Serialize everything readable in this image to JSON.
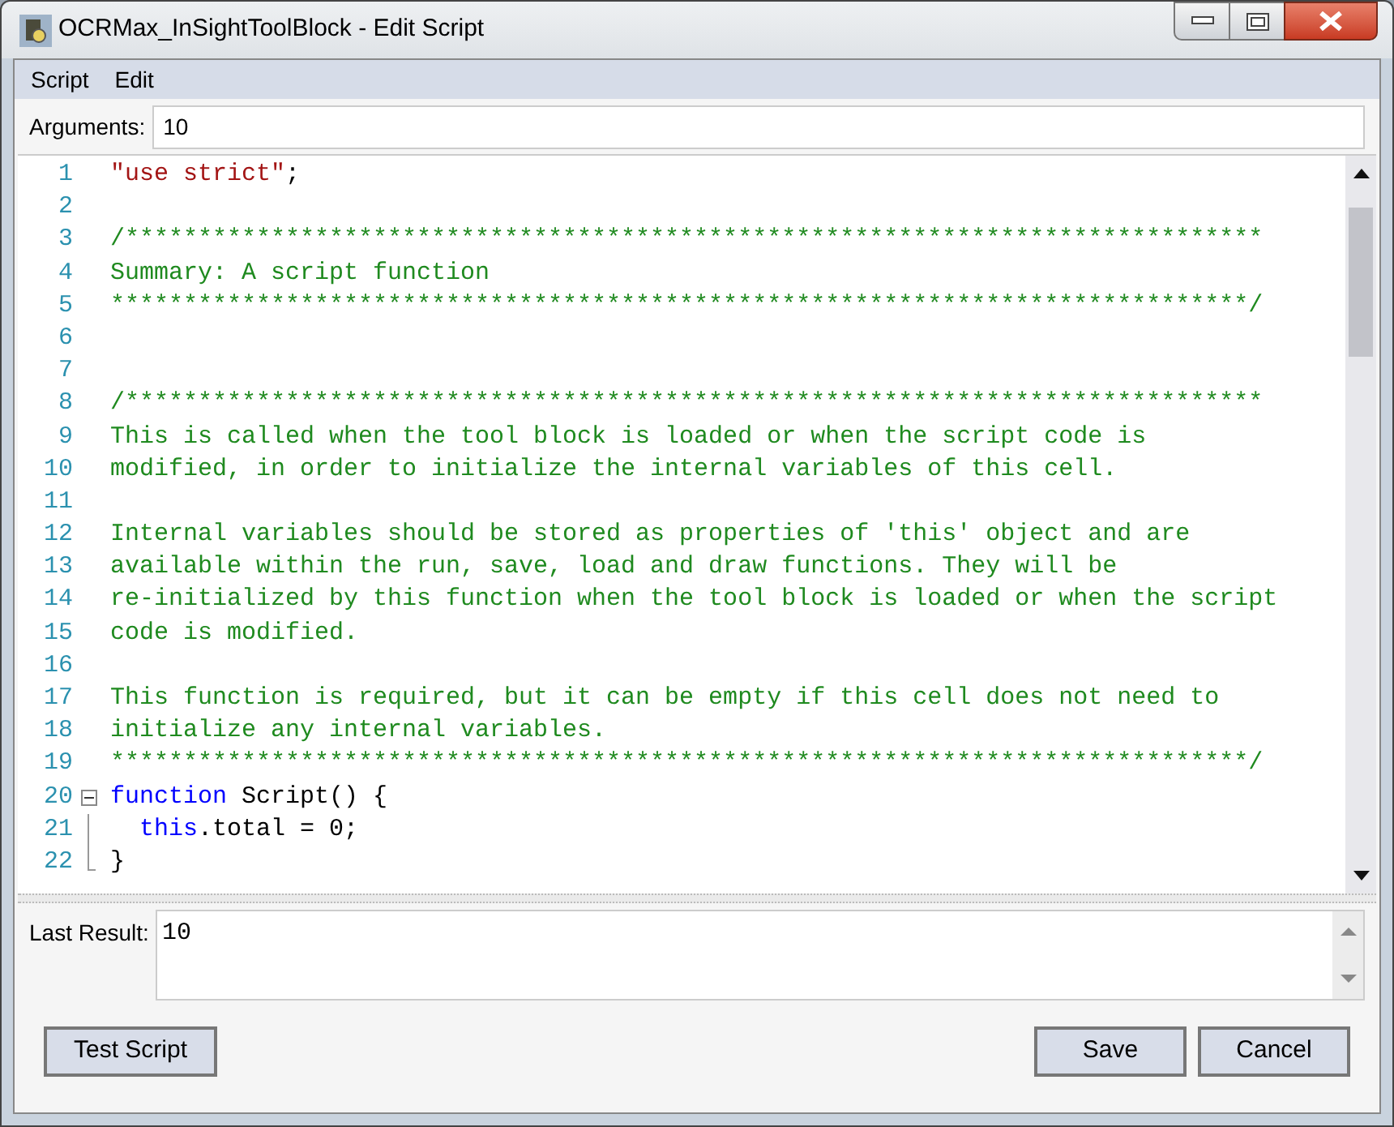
{
  "window": {
    "title": "OCRMax_InSightToolBlock - Edit Script"
  },
  "menu": [
    {
      "label": "Script"
    },
    {
      "label": "Edit"
    }
  ],
  "arguments": {
    "label": "Arguments:",
    "value": "10"
  },
  "editor": {
    "lines": [
      {
        "number": "1",
        "segments": [
          {
            "kind": "string",
            "text": "\"use strict\""
          },
          {
            "kind": "plain",
            "text": ";"
          }
        ]
      },
      {
        "number": "2"
      },
      {
        "number": "3",
        "segments": [
          {
            "kind": "comment",
            "text": "/******************************************************************************"
          }
        ]
      },
      {
        "number": "4",
        "segments": [
          {
            "kind": "comment",
            "text": "Summary: A script function"
          }
        ]
      },
      {
        "number": "5",
        "segments": [
          {
            "kind": "comment",
            "text": "******************************************************************************/"
          }
        ]
      },
      {
        "number": "6"
      },
      {
        "number": "7"
      },
      {
        "number": "8",
        "segments": [
          {
            "kind": "comment",
            "text": "/******************************************************************************"
          }
        ]
      },
      {
        "number": "9",
        "segments": [
          {
            "kind": "comment",
            "text": "This is called when the tool block is loaded or when the script code is"
          }
        ]
      },
      {
        "number": "10",
        "segments": [
          {
            "kind": "comment",
            "text": "modified, in order to initialize the internal variables of this cell."
          }
        ]
      },
      {
        "number": "11"
      },
      {
        "number": "12",
        "segments": [
          {
            "kind": "comment",
            "text": "Internal variables should be stored as properties of 'this' object and are"
          }
        ]
      },
      {
        "number": "13",
        "segments": [
          {
            "kind": "comment",
            "text": "available within the run, save, load and draw functions. They will be"
          }
        ]
      },
      {
        "number": "14",
        "segments": [
          {
            "kind": "comment",
            "text": "re-initialized by this function when the tool block is loaded or when the script"
          }
        ]
      },
      {
        "number": "15",
        "segments": [
          {
            "kind": "comment",
            "text": "code is modified."
          }
        ]
      },
      {
        "number": "16"
      },
      {
        "number": "17",
        "segments": [
          {
            "kind": "comment",
            "text": "This function is required, but it can be empty if this cell does not need to"
          }
        ]
      },
      {
        "number": "18",
        "segments": [
          {
            "kind": "comment",
            "text": "initialize any internal variables."
          }
        ]
      },
      {
        "number": "19",
        "segments": [
          {
            "kind": "comment",
            "text": "******************************************************************************/"
          }
        ]
      },
      {
        "number": "20",
        "kind": "fold_start",
        "segments": [
          {
            "kind": "keyword",
            "text": "function"
          },
          {
            "kind": "plain",
            "text": " Script() {"
          }
        ]
      },
      {
        "number": "21",
        "kind": "fold_body",
        "segments": [
          {
            "kind": "keyword",
            "text": "this"
          },
          {
            "kind": "plain",
            "text": ".total = 0;"
          }
        ]
      },
      {
        "number": "22",
        "kind": "fold_end",
        "segments": [
          {
            "kind": "plain",
            "text": "}"
          }
        ]
      }
    ]
  },
  "last_result": {
    "label": "Last Result:",
    "value": "10"
  },
  "buttons": {
    "left": [
      {
        "label": "Test Script"
      }
    ],
    "right": [
      {
        "label": "Save"
      },
      {
        "label": "Cancel"
      }
    ]
  }
}
